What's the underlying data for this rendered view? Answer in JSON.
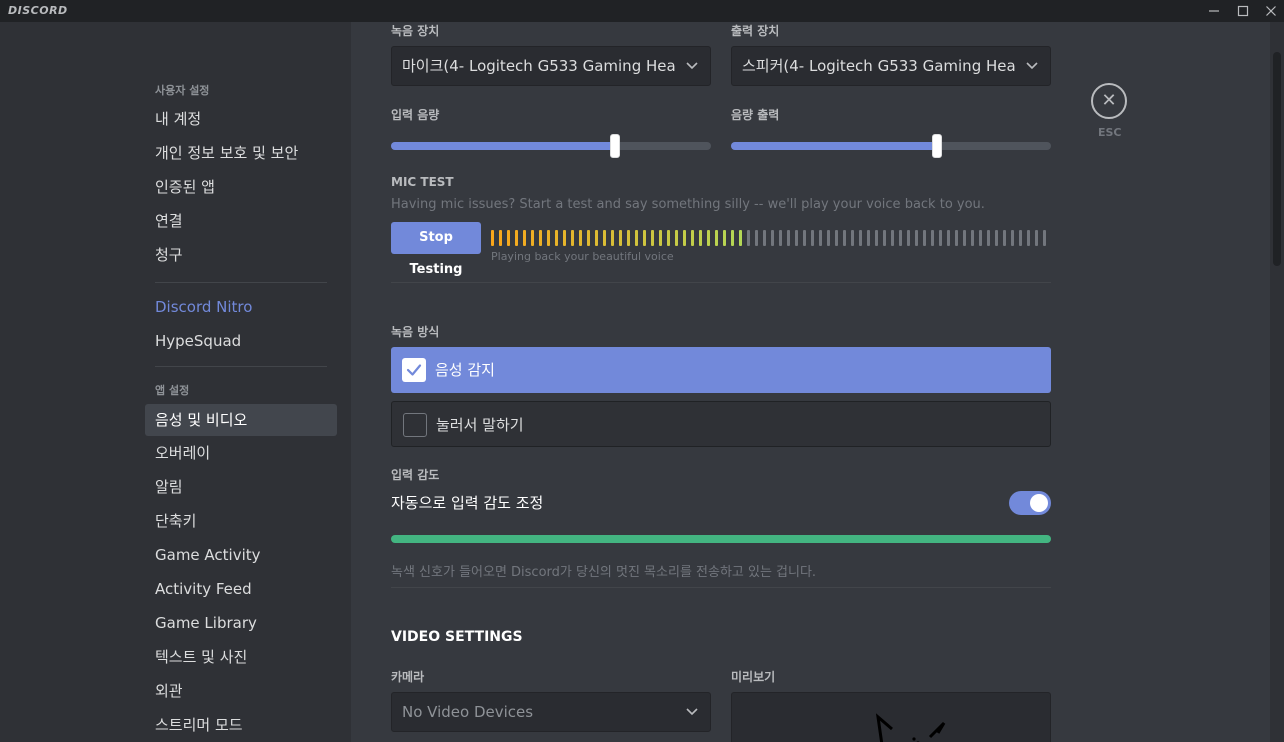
{
  "app": {
    "brand": "DISCORD",
    "window_controls": {
      "minimize": "—",
      "maximize": "☐",
      "close": "✕"
    }
  },
  "sidebar": {
    "user_settings_label": "사용자 설정",
    "user_items": [
      "내 계정",
      "개인 정보 보호 및 보안",
      "인증된 앱",
      "연결",
      "청구"
    ],
    "nitro": "Discord Nitro",
    "hypesquad": "HypeSquad",
    "app_settings_label": "앱 설정",
    "app_items": [
      "음성 및 비디오",
      "오버레이",
      "알림",
      "단축키",
      "Game Activity",
      "Activity Feed",
      "Game Library",
      "텍스트 및 사진",
      "외관",
      "스트리머 모드"
    ],
    "active_item": "음성 및 비디오"
  },
  "voice": {
    "input_device_label": "녹음 장치",
    "input_device_value": "마이크(4- Logitech G533 Gaming Hea",
    "output_device_label": "출력 장치",
    "output_device_value": "스피커(4- Logitech G533 Gaming Hea",
    "input_volume_label": "입력 음량",
    "input_volume_fraction": 0.7,
    "output_volume_label": "음량 출력",
    "output_volume_fraction": 0.645,
    "mic_test_title": "MIC TEST",
    "mic_test_desc": "Having mic issues? Start a test and say something silly -- we'll play your voice back to you.",
    "stop_testing_label": "Stop Testing",
    "meter_caption": "Playing back your beautiful voice",
    "meter_level_fraction": 0.46,
    "input_mode_label": "녹음 방식",
    "mode_voice_activity": "음성 감지",
    "mode_push_to_talk": "눌러서 말하기",
    "selected_mode": "음성 감지",
    "sensitivity_label": "입력 감도",
    "auto_sensitivity_label": "자동으로 입력 감도 조정",
    "auto_sensitivity_enabled": true,
    "sensitivity_hint": "녹색 신호가 들어오면 Discord가 당신의 멋진 목소리를 전송하고 있는 겁니다."
  },
  "video": {
    "section_title": "VIDEO SETTINGS",
    "camera_label": "카메라",
    "camera_value": "No Video Devices",
    "preview_label": "미리보기"
  },
  "esc": {
    "label": "ESC"
  },
  "colors": {
    "accent": "#7289da",
    "green": "#43b581",
    "background": "#36393f",
    "sidebar": "#2f3136",
    "titlebar": "#202225"
  },
  "icons": {
    "dropdown": "chevron-down-icon",
    "close": "close-icon",
    "check": "check-icon"
  }
}
